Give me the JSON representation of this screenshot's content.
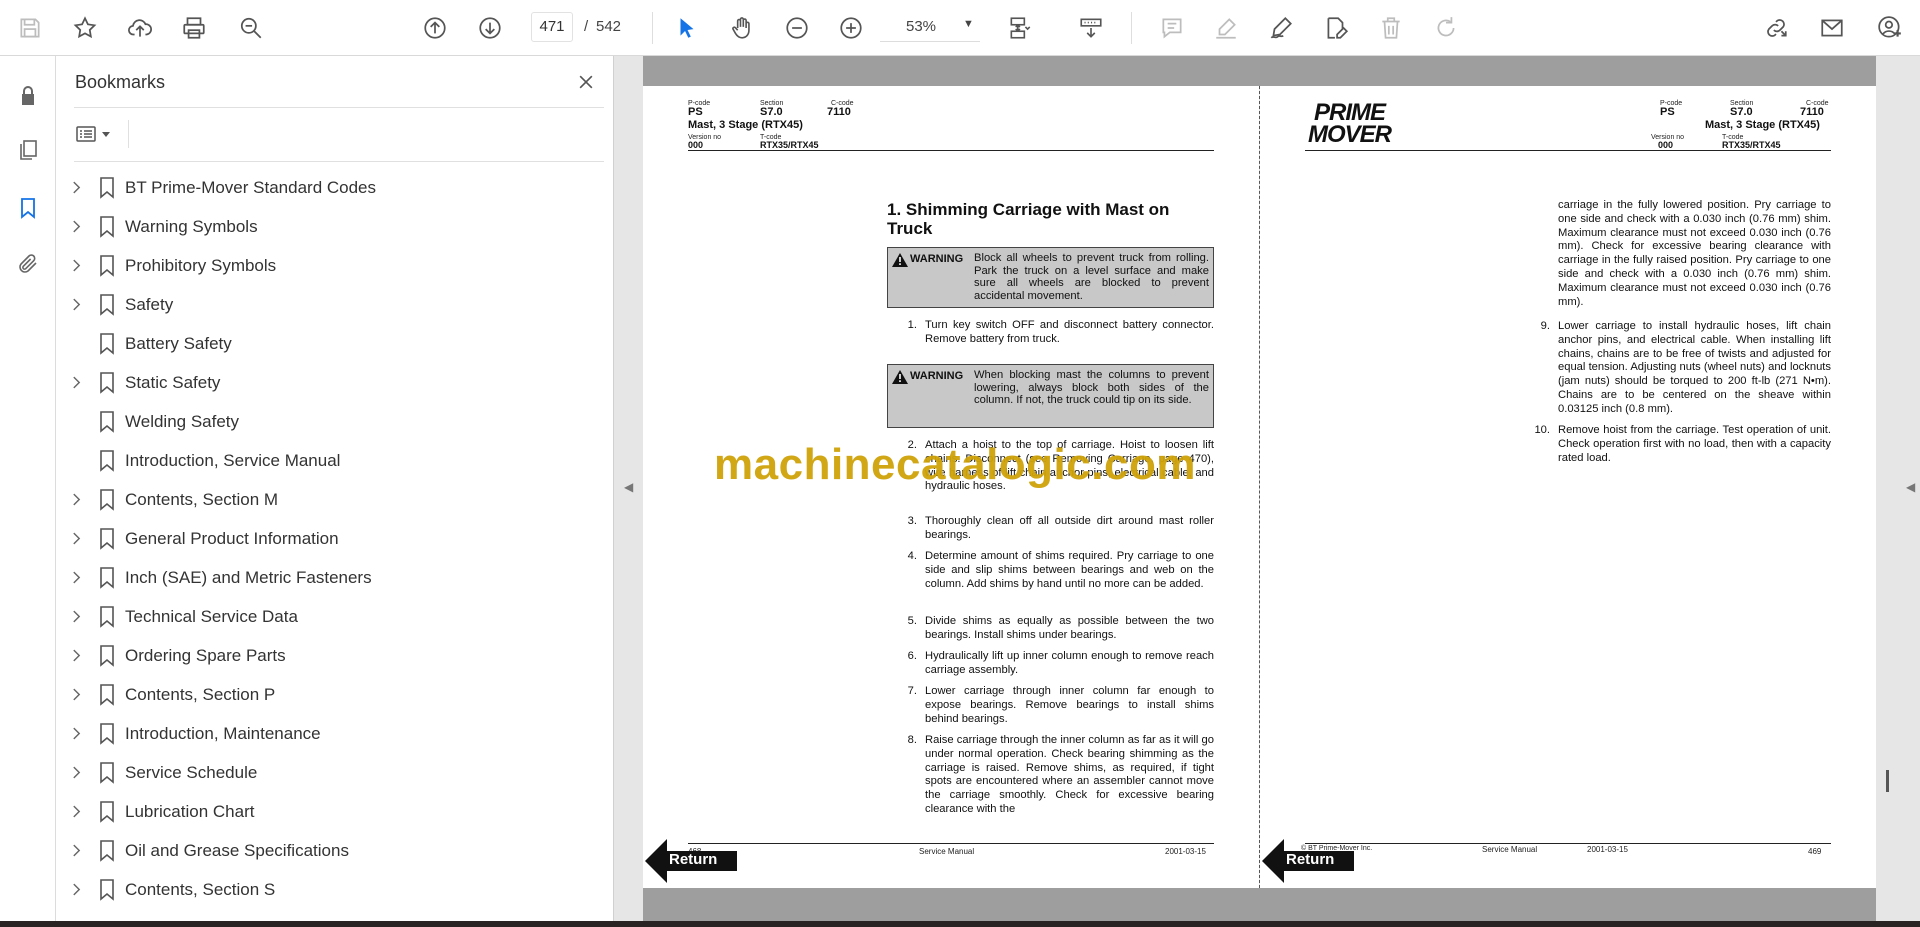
{
  "toolbar": {
    "current_page": "471",
    "page_sep": "/",
    "total_pages": "542",
    "zoom": "53%"
  },
  "bookmarks": {
    "title": "Bookmarks",
    "items": [
      {
        "label": "BT Prime-Mover Standard Codes",
        "expandable": true
      },
      {
        "label": "Warning Symbols",
        "expandable": true
      },
      {
        "label": "Prohibitory Symbols",
        "expandable": true
      },
      {
        "label": "Safety",
        "expandable": true
      },
      {
        "label": "Battery Safety",
        "expandable": false
      },
      {
        "label": "Static Safety",
        "expandable": true
      },
      {
        "label": "Welding Safety",
        "expandable": false
      },
      {
        "label": "Introduction, Service Manual",
        "expandable": false
      },
      {
        "label": "Contents, Section M",
        "expandable": true
      },
      {
        "label": "General Product Information",
        "expandable": true
      },
      {
        "label": "Inch (SAE) and Metric Fasteners",
        "expandable": true
      },
      {
        "label": "Technical Service Data",
        "expandable": true
      },
      {
        "label": "Ordering Spare Parts",
        "expandable": true
      },
      {
        "label": "Contents, Section P",
        "expandable": true
      },
      {
        "label": "Introduction, Maintenance",
        "expandable": true
      },
      {
        "label": "Service Schedule",
        "expandable": true
      },
      {
        "label": "Lubrication Chart",
        "expandable": true
      },
      {
        "label": "Oil and Grease Specifications",
        "expandable": true
      },
      {
        "label": "Contents, Section S",
        "expandable": true
      }
    ]
  },
  "left_page": {
    "hdr": {
      "pcode_label": "P-code",
      "pcode": "PS",
      "section_label": "Section",
      "section": "S7.0",
      "ccode_label": "C-code",
      "ccode": "7110",
      "subtitle": "Mast, 3 Stage (RTX45)",
      "version_label": "Version no",
      "version": "000",
      "tcode_label": "T-code",
      "tcode": "RTX35/RTX45"
    },
    "section_title": "1. Shimming Carriage with Mast on Truck",
    "warning_label": "WARNING",
    "warning1": "Block all wheels to prevent truck from rolling. Park the truck on a level surface and make sure all wheels are blocked to prevent accidental movement.",
    "warning2": "When blocking mast the columns to prevent lowering, always block both sides of the column. If not, the truck could tip on its side.",
    "steps": [
      {
        "num": "1.",
        "text": "Turn key switch OFF and disconnect battery connector. Remove battery from truck."
      },
      {
        "num": "2.",
        "text": "Attach a hoist to the top of carriage. Hoist to loosen lift chains. Disconnect (see Removing Carriage, page 470), wire harness of lift chain anchor pins, electrical cable, and hydraulic hoses."
      },
      {
        "num": "3.",
        "text": "Thoroughly clean off all outside dirt around mast roller bearings."
      },
      {
        "num": "4.",
        "text": "Determine amount of shims required. Pry carriage to one side and slip shims between bearings and web on the column. Add shims by hand until no more can be added."
      },
      {
        "num": "5.",
        "text": "Divide shims as equally as possible between the two bearings. Install shims under bearings."
      },
      {
        "num": "6.",
        "text": "Hydraulically lift up inner column enough to remove reach carriage assembly."
      },
      {
        "num": "7.",
        "text": "Lower carriage through inner column far enough to expose bearings. Remove bearings to install shims behind bearings."
      },
      {
        "num": "8.",
        "text": "Raise carriage through the inner column as far as it will go under normal operation. Check bearing shimming as the carriage is raised. Remove shims, as required, if tight spots are encountered where an assembler cannot move the carriage smoothly. Check for excessive bearing clearance with the"
      }
    ],
    "foot": {
      "page": "468",
      "center": "Service Manual",
      "date": "2001-03-15"
    },
    "return_label": "Return"
  },
  "right_page": {
    "logo_line1": "PRIME",
    "logo_line2": "MOVER",
    "hdr": {
      "pcode_label": "P-code",
      "pcode": "PS",
      "section_label": "Section",
      "section": "S7.0",
      "ccode_label": "C-code",
      "ccode": "7110",
      "subtitle": "Mast, 3 Stage (RTX45)",
      "version_label": "Version no",
      "version": "000",
      "tcode_label": "T-code",
      "tcode": "RTX35/RTX45"
    },
    "continued": "carriage in the fully lowered position. Pry carriage to one side and check with a 0.030 inch (0.76 mm) shim. Maximum clearance must not exceed 0.030 inch (0.76 mm). Check for excessive bearing clearance with carriage in the fully raised position. Pry carriage to one side and check with a 0.030 inch (0.76 mm) shim. Maximum clearance must not exceed 0.030 inch (0.76 mm).",
    "steps": [
      {
        "num": "9.",
        "text": "Lower carriage to install hydraulic hoses, lift chain anchor pins, and electrical cable. When installing lift chains, chains are to be free of twists and adjusted for equal tension. Adjusting nuts (wheel nuts) and locknuts (jam nuts) should be torqued to 200 ft-lb (271 N•m). Chains are to be centered on the sheave within 0.03125 inch (0.8 mm)."
      },
      {
        "num": "10.",
        "text": "Remove hoist from the carriage. Test operation of unit. Check operation first with no load, then with a capacity rated load."
      }
    ],
    "foot": {
      "copyright": "© BT Prime-Mover Inc.",
      "center": "Service Manual",
      "date": "2001-03-15",
      "page": "469"
    },
    "return_label": "Return"
  },
  "watermark": "machinecatalogic.com",
  "colors": {
    "accent": "#1473e6",
    "watermark": "#cfa30a",
    "page_bar": "#9e9e9e"
  }
}
